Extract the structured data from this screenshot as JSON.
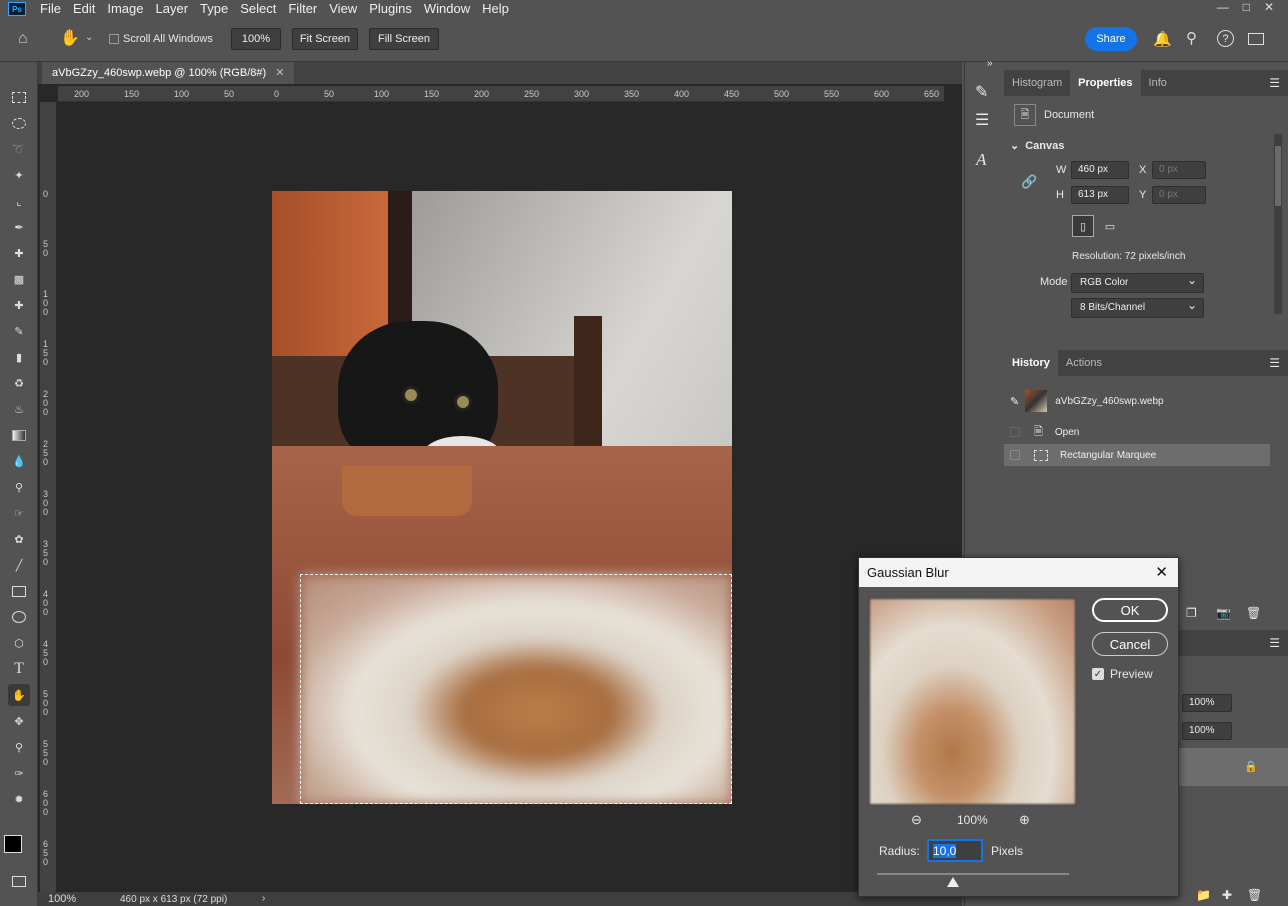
{
  "menu": [
    "File",
    "Edit",
    "Image",
    "Layer",
    "Type",
    "Select",
    "Filter",
    "View",
    "Plugins",
    "Window",
    "Help"
  ],
  "app_logo": "Ps",
  "options": {
    "scroll_all_windows": "Scroll All Windows",
    "zoom": "100%",
    "fit_screen": "Fit Screen",
    "fill_screen": "Fill Screen",
    "share": "Share"
  },
  "document": {
    "tab_title": "aVbGZzy_460swp.webp @ 100% (RGB/8#)",
    "zoom": "100%",
    "status": "460 px x 613 px (72 ppi)"
  },
  "ruler_h": [
    "200",
    "150",
    "100",
    "50",
    "0",
    "50",
    "100",
    "150",
    "200",
    "250",
    "300",
    "350",
    "400",
    "450",
    "500",
    "550",
    "600",
    "650"
  ],
  "ruler_v": [
    "0",
    "5 0",
    "1 0 0",
    "1 5 0",
    "2 0 0",
    "2 5 0",
    "3 0 0",
    "3 5 0",
    "4 0 0",
    "4 5 0",
    "5 0 0",
    "5 5 0",
    "6 0 0",
    "6 5 0"
  ],
  "properties": {
    "tabs": [
      "Histogram",
      "Properties",
      "Info"
    ],
    "active_tab": "Properties",
    "doc_label": "Document",
    "canvas_section": "Canvas",
    "w_label": "W",
    "w_value": "460 px",
    "h_label": "H",
    "h_value": "613 px",
    "x_label": "X",
    "x_value": "0 px",
    "y_label": "Y",
    "y_value": "0 px",
    "resolution": "Resolution: 72 pixels/inch",
    "mode_label": "Mode",
    "mode_value": "RGB Color",
    "bits_value": "8 Bits/Channel"
  },
  "history": {
    "tabs": [
      "History",
      "Actions"
    ],
    "snapshot": "aVbGZzy_460swp.webp",
    "items": [
      "Open",
      "Rectangular Marquee"
    ]
  },
  "layers_partial": {
    "opacity": "100%",
    "fill": "100%"
  },
  "dialog": {
    "title": "Gaussian Blur",
    "ok": "OK",
    "cancel": "Cancel",
    "preview_label": "Preview",
    "preview_checked": true,
    "zoom": "100%",
    "radius_label": "Radius:",
    "radius_value": "10,0",
    "units": "Pixels"
  },
  "colors": {
    "accent": "#1473e6",
    "panel": "#535353",
    "canvas_bg": "#282828"
  }
}
